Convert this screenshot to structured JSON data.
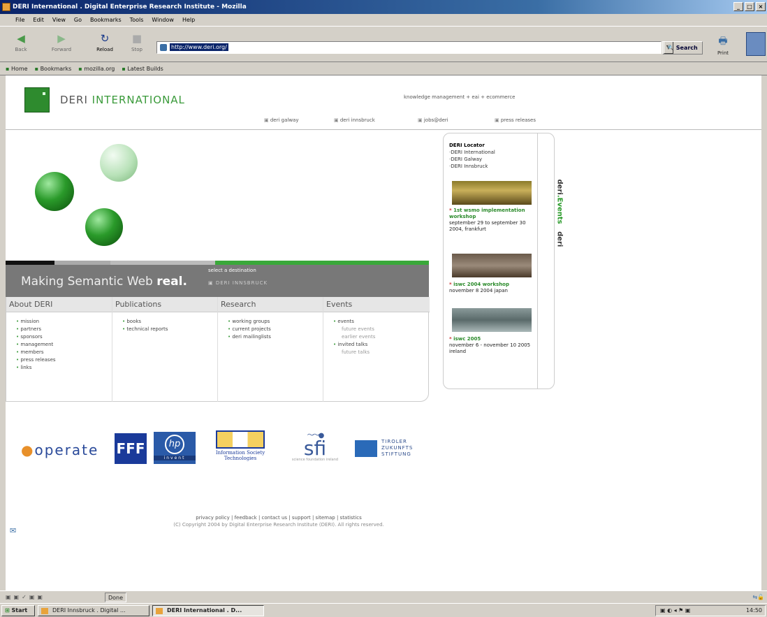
{
  "window": {
    "title": "DERI International . Digital Enterprise Research Institute - Mozilla"
  },
  "menu": [
    "File",
    "Edit",
    "View",
    "Go",
    "Bookmarks",
    "Tools",
    "Window",
    "Help"
  ],
  "toolbar": {
    "back": "Back",
    "forward": "Forward",
    "reload": "Reload",
    "stop": "Stop",
    "search": "Search",
    "print": "Print"
  },
  "url": "http://www.deri.org/",
  "personal_toolbar": [
    "Home",
    "Bookmarks",
    "mozilla.org",
    "Latest Builds"
  ],
  "site": {
    "brand_a": "DERI ",
    "brand_b": "INTERNATIONAL",
    "tagline": "knowledge management + eai + ecommerce",
    "topnav": [
      "deri galway",
      "deri innsbruck",
      "jobs@deri",
      "press releases"
    ],
    "slogan_a": "Making Semantic Web ",
    "slogan_b": "real.",
    "select_destination": "select a destination",
    "destination_value": "DERI INNSBRUCK",
    "columns": [
      {
        "title": "About DERI",
        "items": [
          "mission",
          "partners",
          "sponsors",
          "management",
          "members",
          "press releases",
          "links"
        ]
      },
      {
        "title": "Publications",
        "items": [
          "books",
          "technical reports"
        ]
      },
      {
        "title": "Research",
        "items": [
          "working groups",
          "current projects",
          "deri mailinglists"
        ]
      },
      {
        "title": "Events",
        "items": [
          "events",
          "future events",
          "earlier events",
          "invited talks",
          "future talks"
        ]
      }
    ],
    "locator": {
      "title": "DERI Locator",
      "items": [
        "DERI International",
        "DERI Galway",
        "DERI Innsbruck"
      ]
    },
    "events_label_a": "deri",
    "events_label_b": ".Events",
    "events_label_c": "deri",
    "events": [
      {
        "title": "1st wsmo implementation workshop",
        "detail": "september 29 to september 30 2004, frankfurt"
      },
      {
        "title": "iswc 2004 workshop",
        "detail": "november 8 2004 japan"
      },
      {
        "title": "iswc 2005",
        "detail": "november 6 - november 10 2005 ireland"
      }
    ],
    "logos": {
      "operate": "operate",
      "fff": "FFF",
      "hp": "invent",
      "ist": "Information Society Technologies",
      "sfi": "sfi",
      "sfi_sub": "science foundation ireland",
      "tiroler": [
        "TIROLER",
        "ZUKUNFTS",
        "STIFTUNG"
      ]
    },
    "footer_links": "privacy policy | feedback | contact us | support | sitemap | statistics",
    "copyright": "(C) Copyright 2004 by Digital Enterprise Research Institute (DERI). All rights reserved."
  },
  "status": "Done",
  "taskbar": {
    "start": "Start",
    "tasks": [
      "DERI Innsbruck . Digital ...",
      "DERI International . D..."
    ],
    "clock": "14:50"
  },
  "colors": {
    "accent_green": "#2e8b2e",
    "title_blue": "#0a246a",
    "slogan_grey": "#787878"
  }
}
